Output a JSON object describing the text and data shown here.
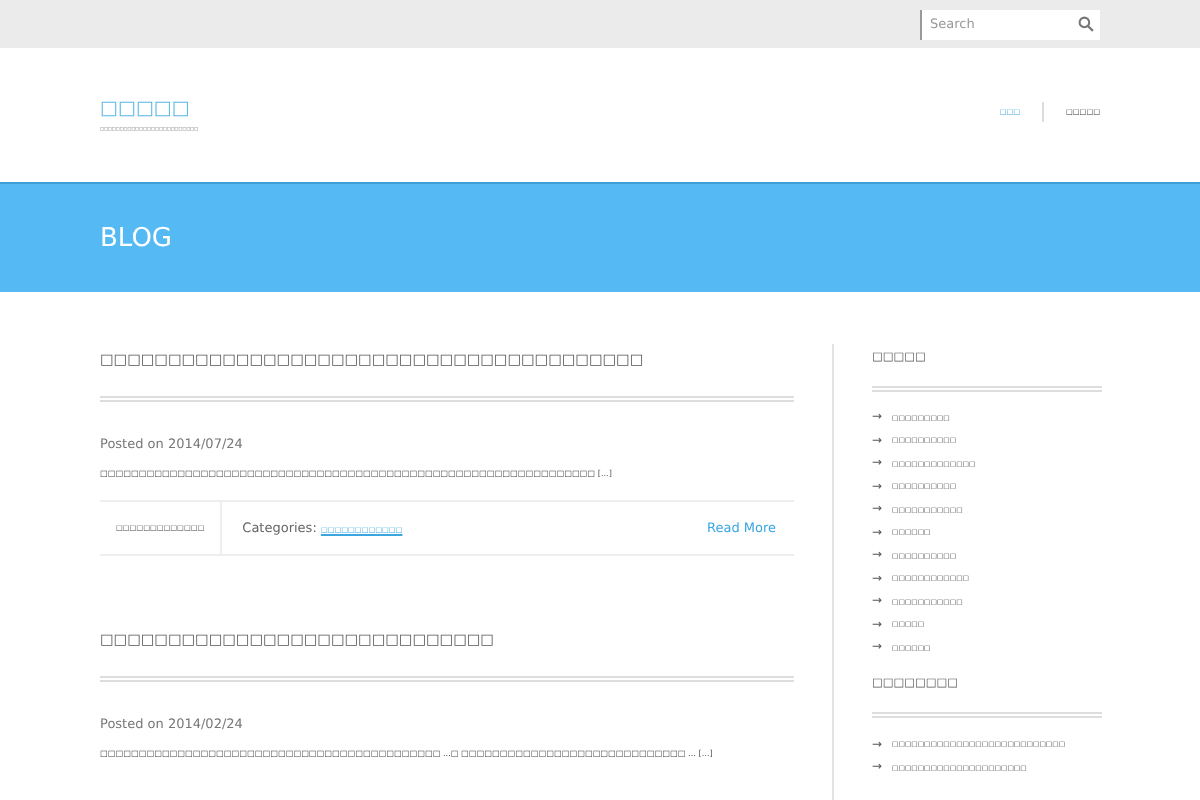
{
  "search": {
    "placeholder": "Search"
  },
  "header": {
    "logo": "□□□□□",
    "tagline": "□□□□□□□□□□□□□□□□□□□□□□□□□",
    "nav": [
      {
        "label": "□□□",
        "selected": true
      },
      {
        "label": "□□□□□",
        "selected": false
      }
    ]
  },
  "banner": {
    "title": "BLOG"
  },
  "posts": [
    {
      "title": "□□□□□□□□□□□□□□□□□□□□□□□□□□□□□□□□□□□□□□□□",
      "posted": "Posted on 2014/07/24",
      "excerpt": "□□□□□□□□□□□□□□□□□□□□□□□□□□□□□□□□□□□□□□□□□□□□□□□□□□□□□□□□□□□□□□□□",
      "more": "[...]",
      "author": "□□□□□□□□□□□□□",
      "categories_label": "Categories:",
      "category": "□□□□□□□□□□□□",
      "read_more": "Read More"
    },
    {
      "title": "□□□□□□□□□□□□□□□□□□□□□□□□□□□□□",
      "posted": "Posted on 2014/02/24",
      "excerpt": "□□□□□□□□□□□□□□□□□□□□□□□□□□□□□□□□□□□□□□□□□□□□ ...□ □□□□□□□□□□□□□□□□□□□□□□□□□□□□□ ...",
      "more": "[...]"
    }
  ],
  "sidebar": [
    {
      "heading": "□□□□□",
      "items": [
        {
          "arrow": "→",
          "label": "□□□□□□□□□"
        },
        {
          "arrow": "→",
          "label": "□□□□□□□□□□"
        },
        {
          "arrow": "→",
          "label": "□□□□□□□□□□□□□"
        },
        {
          "arrow": "→",
          "label": "□□□□□□□□□□"
        },
        {
          "arrow": "→",
          "label": "□□□□□□□□□□□"
        },
        {
          "arrow": "→",
          "label": "□□□□□□"
        },
        {
          "arrow": "→",
          "label": "□□□□□□□□□□"
        },
        {
          "arrow": "→",
          "label": "□□□□□□□□□□□□"
        },
        {
          "arrow": "→",
          "label": "□□□□□□□□□□□"
        },
        {
          "arrow": "→",
          "label": "□□□□□"
        },
        {
          "arrow": "→",
          "label": "□□□□□□"
        }
      ]
    },
    {
      "heading": "□□□□□□□□",
      "items": [
        {
          "arrow": "→",
          "label": "□□□□□□□□□□□□□□□□□□□□□□□□□□□"
        },
        {
          "arrow": "→",
          "label": "□□□□□□□□□□□□□□□□□□□□□"
        }
      ]
    }
  ]
}
